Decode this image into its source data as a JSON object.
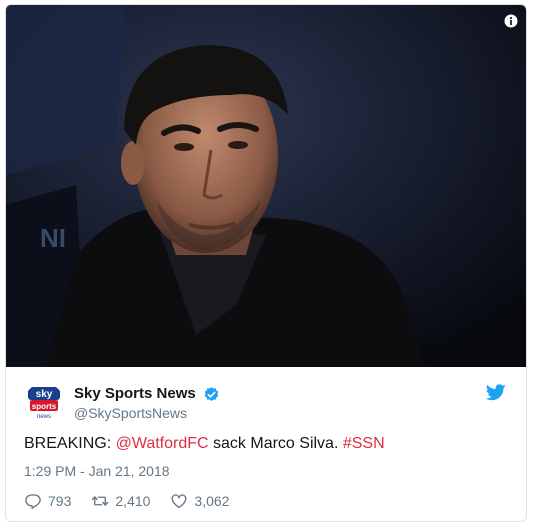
{
  "tweet": {
    "media_alt": "photo",
    "author": {
      "display_name": "Sky Sports News",
      "handle": "@SkySportsNews",
      "logo_top": "sky",
      "logo_mid": "sports",
      "logo_bottom": "news"
    },
    "text": {
      "prefix": "BREAKING: ",
      "mention": "@WatfordFC",
      "middle": " sack Marco Silva. ",
      "hashtag": "#SSN"
    },
    "timestamp": "1:29 PM - Jan 21, 2018",
    "replies": "793",
    "retweets": "2,410",
    "likes": "3,062"
  },
  "colors": {
    "link": "#dd2e44",
    "muted": "#657786",
    "verified": "#1da1f2",
    "twitter_blue": "#1da1f2"
  },
  "icons": [
    "info-icon",
    "verified-badge-icon",
    "twitter-bird-icon",
    "reply-icon",
    "retweet-icon",
    "like-icon"
  ]
}
